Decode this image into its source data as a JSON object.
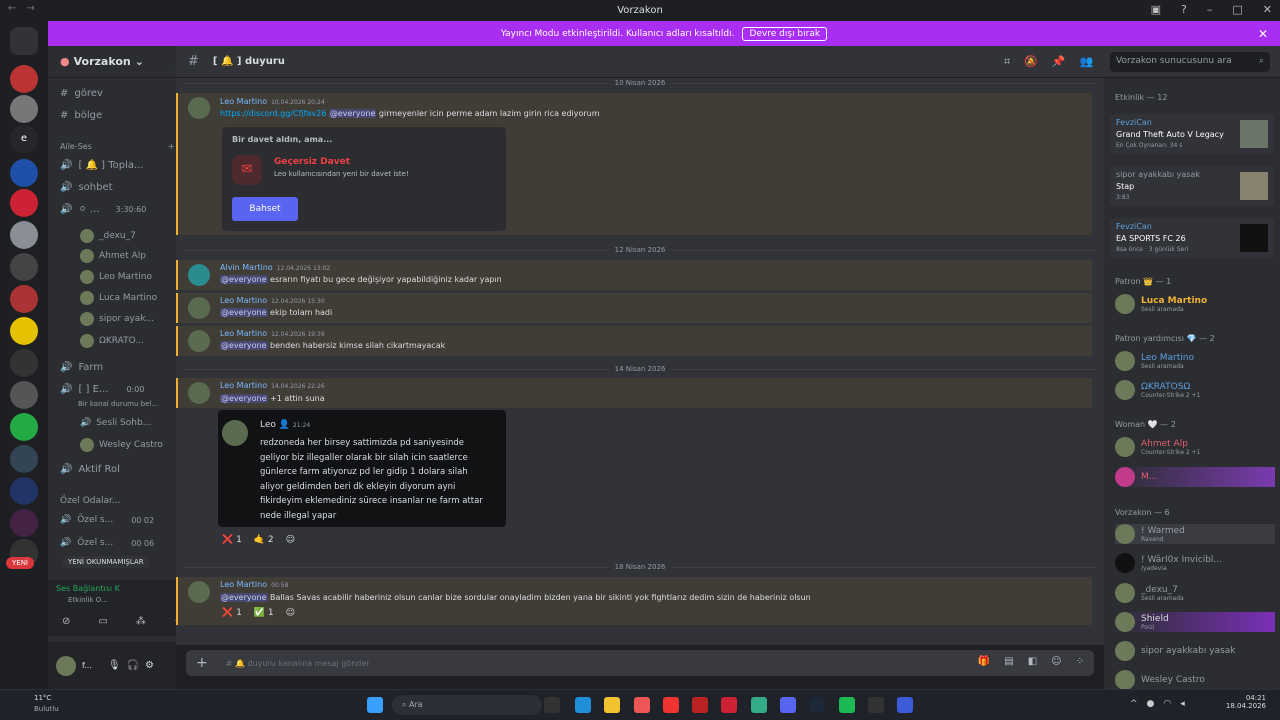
{
  "window": {
    "title": "Vorzakon"
  },
  "banner": {
    "text": "Yayıncı Modu etkinleştirildi. Kullanıcı adları kısaltıldı.",
    "button": "Devre dışı bırak"
  },
  "server": {
    "name": "Vorzakon"
  },
  "sidebar": {
    "channels": [
      {
        "name": "görev"
      },
      {
        "name": "bölge"
      }
    ],
    "category": "Aile-Ses",
    "voice": [
      {
        "name": "[ 🔔 ] Topla..."
      },
      {
        "name": "sohbet"
      },
      {
        "name": "⚪ ...",
        "timer": "3:30:60"
      },
      {
        "name": "Farm"
      },
      {
        "name": "[ ] E...",
        "timer": "0:00"
      },
      {
        "name": "Sesli Sohb..."
      },
      {
        "name": "Aktif Rol"
      },
      {
        "name": "Özel Odalar..."
      },
      {
        "name": "Özel s...",
        "count": "00 02"
      },
      {
        "name": "Özel s...",
        "count": "00 06"
      }
    ],
    "voice_users": [
      "_dexu_7",
      "Ahmet Alp",
      "Leo Martino",
      "Luca Martino",
      "sipor ayak...",
      "ΩKRATO..."
    ],
    "status_line": "Bir kanal durumu bel...",
    "sub_users": [
      "Wesley Castro"
    ],
    "new_pill": "YENİ",
    "unread_pill": "YENİ OKUNMAMIŞLAR",
    "connection": {
      "title": "Ses Bağlantısı K",
      "sub": "Etkinlik O..."
    },
    "user": {
      "name": "f..."
    }
  },
  "channel": {
    "name": "duyuru",
    "search_placeholder": "Vorzakon sunucusunu ara"
  },
  "chat": {
    "dates": [
      "10 Nisan 2026",
      "12 Nisan 2026",
      "14 Nisan 2026",
      "18 Nisan 2026"
    ],
    "messages": [
      {
        "author": "Leo Martino",
        "time": "10.04.2026 20:24",
        "link": "https://discord.gg/Cfjfav26",
        "mention": "@everyone",
        "text": "girmeyenler icin perme adam lazim girin rica ediyorum"
      },
      {
        "author": "Alvin Martino",
        "time": "12.04.2026 13:02",
        "mention": "@everyone",
        "text": "esrarın fiyatı bu gece değişiyor yapabildiğiniz kadar yapın"
      },
      {
        "author": "Leo Martino",
        "time": "12.04.2026 15:30",
        "mention": "@everyone",
        "text": "ekip tolam hadi"
      },
      {
        "author": "Leo Martino",
        "time": "12.04.2026 19:39",
        "mention": "@everyone",
        "text": "benden habersiz kimse silah cikartmayacak"
      },
      {
        "author": "Leo Martino",
        "time": "14.04.2026 22:26",
        "mention": "@everyone",
        "text": "+1 attin suna"
      },
      {
        "author": "Leo Martino",
        "time": "00:58",
        "mention": "@everyone",
        "text": "Ballas Savas acabilir haberiniz olsun  canlar bize sordular onayladim bizden yana bir sikinti yok fightlarız dedim sizin de haberiniz olsun"
      }
    ],
    "invite": {
      "heading": "Bir davet aldın, ama...",
      "title": "Geçersiz Davet",
      "sub": "Leo kullanıcısından yeni bir davet iste!",
      "button": "Bahset"
    },
    "quote": {
      "author": "Leo",
      "time": "21:24",
      "lines": [
        "redzoneda her birsey sattimizda pd saniyesinde",
        "geliyor biz illegaller olarak bir silah icin saatlerce",
        "günlerce farm atiyoruz pd ler gidip 1 dolara silah",
        "aliyor geldimden beri dk ekleyin diyorum ayni",
        "fikirdeyim eklemediniz sürece insanlar ne farm attar",
        "nede illegal yapar"
      ]
    },
    "reactions_a": [
      "❌ 1",
      "🤙 2"
    ],
    "reactions_b": [
      "❌ 1",
      "✅ 1"
    ]
  },
  "composer": {
    "placeholder": "duyuru kanalına mesaj gönder"
  },
  "members": {
    "activity_header": "Etkinlik — 12",
    "activities": [
      {
        "user": "FevziCan",
        "game": "Grand Theft Auto V Legacy",
        "sub": "En Çok Oynanan: 34 s"
      },
      {
        "user": "sipor ayakkabı yasak",
        "game": "Stap",
        "sub": "3:83"
      },
      {
        "user": "FevziCan",
        "game": "EA SPORTS FC 26",
        "sub": "8sa önce · 3 günlük Seri"
      }
    ],
    "groups": [
      {
        "label": "Patron 👑 — 1",
        "users": [
          {
            "name": "Luca Martino",
            "sub": "Sesli aramada"
          }
        ]
      },
      {
        "label": "Patron yardımcısı 💎 — 2",
        "users": [
          {
            "name": "Leo Martino",
            "sub": "Sesli aramada"
          },
          {
            "name": "ΩKRATOSΩ",
            "sub": "Counter-Strike 2 +1"
          }
        ]
      },
      {
        "label": "Woman 🤍 — 2",
        "users": [
          {
            "name": "Ahmet Alp",
            "sub": "Counter-Strike 2 +1"
          },
          {
            "name": "M...",
            "sub": ""
          }
        ]
      },
      {
        "label": "Vorzakon — 6",
        "users": [
          {
            "name": "! Warmed",
            "sub": "Ravend"
          },
          {
            "name": "! WârI0x Invicibl...",
            "sub": "/yadevia"
          },
          {
            "name": "_dexu_7",
            "sub": "Sesli aramada"
          },
          {
            "name": "Shield",
            "sub": "Poizi"
          },
          {
            "name": "sipor ayakkabı yasak",
            "sub": ""
          },
          {
            "name": "Wesley Castro",
            "sub": ""
          }
        ]
      }
    ]
  },
  "taskbar": {
    "weather": "11°C",
    "weather_sub": "Bulutlu",
    "search": "Ara",
    "time": "04:21",
    "date": "18.04.2026"
  },
  "colors": {
    "banner": "#a82ef2",
    "accent": "#5865f2",
    "mention_border": "#f0b132"
  }
}
